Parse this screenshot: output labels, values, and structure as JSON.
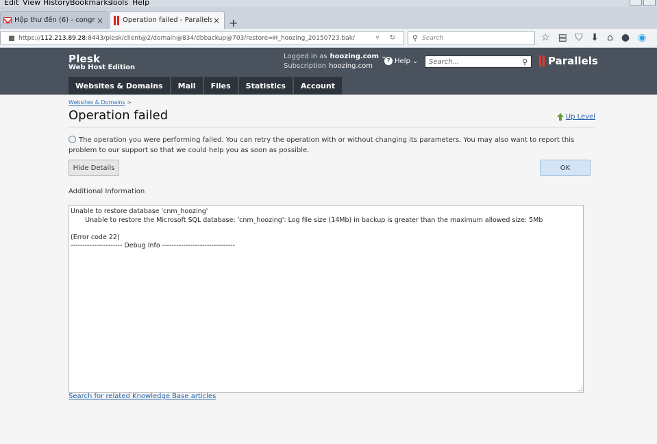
{
  "browser": {
    "menu": [
      "Edit",
      "View",
      "History",
      "Bookmarks",
      "Tools",
      "Help"
    ],
    "tabs": [
      {
        "title": "Hộp thư đến (6) - congnv....",
        "active": false
      },
      {
        "title": "Operation failed - Parallels ...",
        "active": true
      }
    ],
    "new_tab": "+",
    "close_glyph": "×",
    "url_host": "112.213.89.28",
    "url_prefix": "https://",
    "url_rest": ":8443/plesk/client@2/domain@834/dbbackup@703/restore=H_hoozing_20150723.bak/",
    "search_placeholder": "Search"
  },
  "plesk": {
    "brand_line1": "Plesk",
    "brand_line2": "Web Host Edition",
    "logged_in_label": "Logged in as",
    "logged_in_value": "hoozing.com",
    "subscription_label": "Subscription",
    "subscription_value": "hoozing.com",
    "help_label": "Help",
    "search_placeholder": "Search...",
    "logo_text": "Parallels",
    "nav_tabs": [
      "Websites & Domains",
      "Mail",
      "Files",
      "Statistics",
      "Account"
    ]
  },
  "page": {
    "breadcrumb_link": "Websites & Domains",
    "breadcrumb_sep": ">",
    "title": "Operation failed",
    "up_level": "Up Level",
    "message": "The operation you were performing failed. You can retry the operation with or without changing its parameters. You may also want to report this problem to our support so that we could help you as soon as possible.",
    "hide_details": "Hide Details",
    "ok": "OK",
    "additional_info_label": "Additional Information",
    "details_text": "Unable to restore database 'cnm_hoozing'\n       Unable to restore the Microsoft SQL database: 'cnm_hoozing': Log file size (14Mb) in backup is greater than the maximum allowed size: 5Mb\n\n(Error code 22)\n---------------------- Debug Info -------------------------------",
    "kb_link": "Search for related Knowledge Base articles"
  },
  "colors": {
    "header_bg": "#4a535d",
    "nav_tab_bg": "#2d343b",
    "link": "#2463a8",
    "parallels_red": "#e23a2e"
  }
}
